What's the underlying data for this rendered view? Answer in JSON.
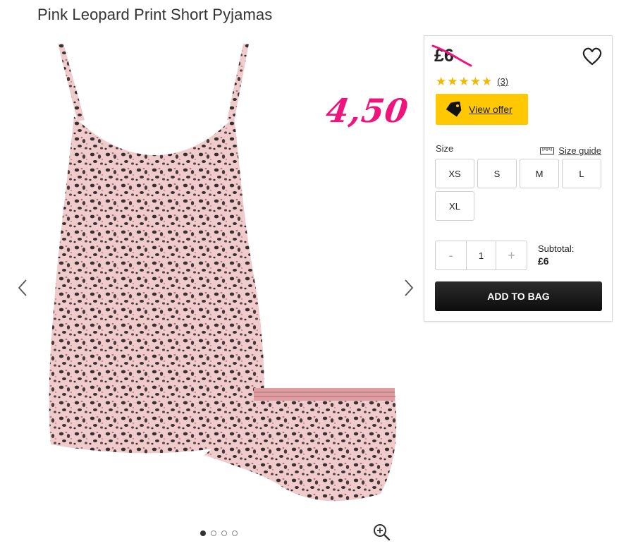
{
  "product": {
    "title": "Pink Leopard Print Short Pyjamas",
    "promo_price": "4,50"
  },
  "gallery": {
    "image_alt": "pink-leopard-pyjamas-photo",
    "dots_count": 4,
    "active_dot": 0
  },
  "buybox": {
    "old_price": "£6",
    "rating": {
      "stars": 5,
      "review_count": "(3)"
    },
    "offer_label": "View offer",
    "size_label": "Size",
    "size_guide_label": "Size guide",
    "sizes": [
      "XS",
      "S",
      "M",
      "L",
      "XL"
    ],
    "quantity": {
      "minus": "-",
      "value": "1",
      "plus": "+"
    },
    "subtotal_label": "Subtotal:",
    "subtotal_value": "£6",
    "add_to_bag_label": "ADD TO BAG"
  },
  "colors": {
    "promo_pink": "#f0137c",
    "offer_yellow": "#ffc800",
    "star_gold": "#f5b700",
    "button_black": "#1a1a1a"
  }
}
